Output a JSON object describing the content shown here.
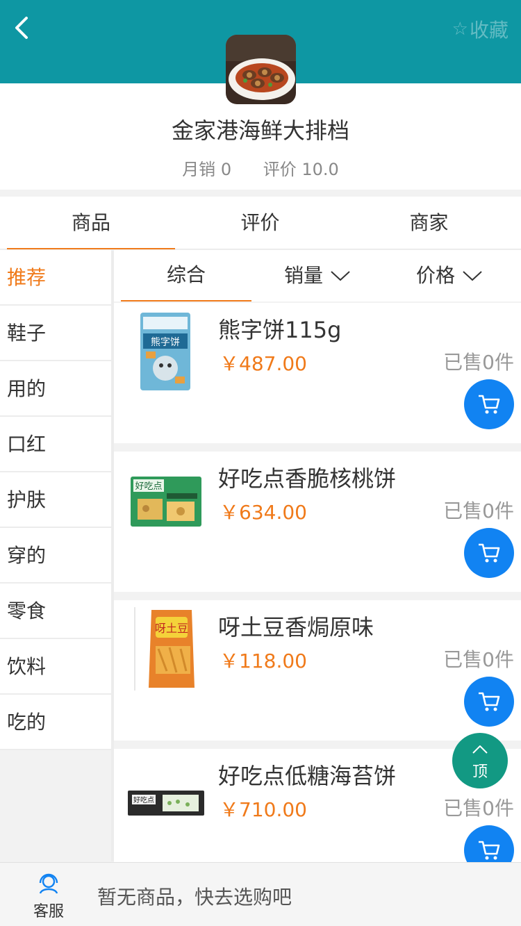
{
  "header": {
    "favorite_label": "收藏"
  },
  "shop": {
    "name": "金家港海鲜大排档",
    "monthly_sales": "月销 0",
    "rating": "评价 10.0"
  },
  "tabs": [
    {
      "label": "商品"
    },
    {
      "label": "评价"
    },
    {
      "label": "商家"
    }
  ],
  "categories": [
    {
      "label": "推荐"
    },
    {
      "label": "鞋子"
    },
    {
      "label": "用的"
    },
    {
      "label": "口红"
    },
    {
      "label": "护肤"
    },
    {
      "label": "穿的"
    },
    {
      "label": "零食"
    },
    {
      "label": "饮料"
    },
    {
      "label": "吃的"
    }
  ],
  "sort": [
    {
      "label": "综合"
    },
    {
      "label": "销量"
    },
    {
      "label": "价格"
    }
  ],
  "products": [
    {
      "name": "熊字饼115g",
      "price": "￥487.00",
      "sold": "已售0件"
    },
    {
      "name": "好吃点香脆核桃饼",
      "price": "￥634.00",
      "sold": "已售0件"
    },
    {
      "name": "呀土豆香焗原味",
      "price": "￥118.00",
      "sold": "已售0件"
    },
    {
      "name": "好吃点低糖海苔饼",
      "price": "￥710.00",
      "sold": "已售0件"
    }
  ],
  "to_top_label": "顶",
  "bottom": {
    "service_label": "客服",
    "empty_text": "暂无商品，快去选购吧"
  },
  "colors": {
    "header_bg": "#0e97a3",
    "accent_orange": "#f07a1a",
    "cart_blue": "#1183f2",
    "to_top_green": "#129983"
  }
}
